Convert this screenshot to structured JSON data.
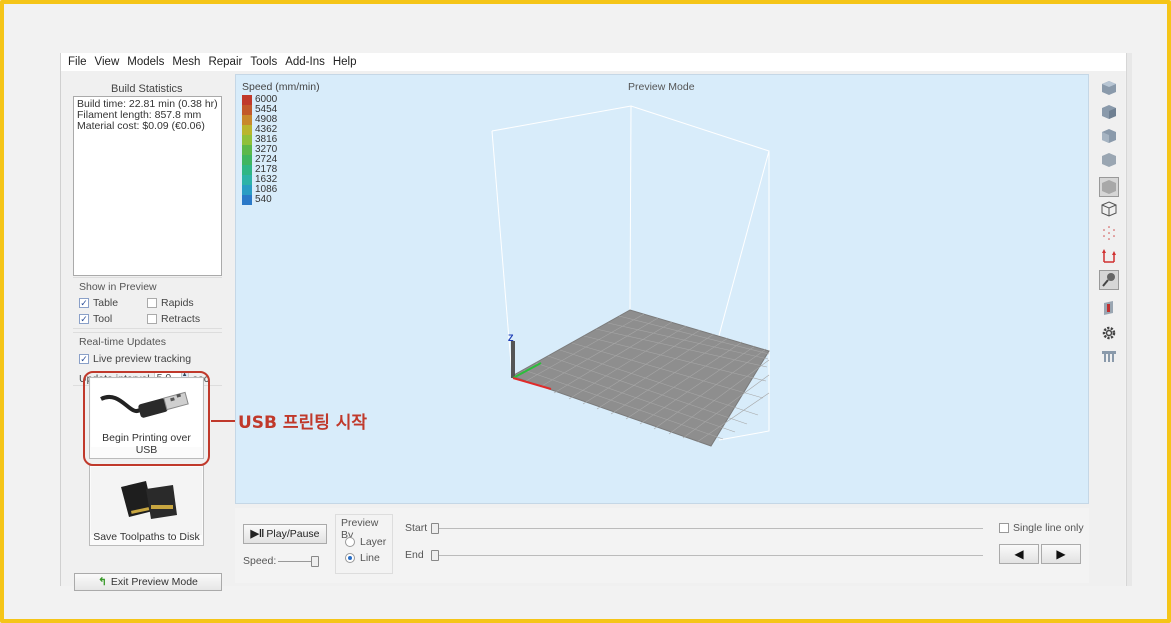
{
  "menu": [
    "File",
    "View",
    "Models",
    "Mesh",
    "Repair",
    "Tools",
    "Add-Ins",
    "Help"
  ],
  "build_statistics": {
    "title": "Build Statistics",
    "lines": [
      "Build time: 22.81 min (0.38 hr)",
      "Filament length: 857.8 mm",
      "Material cost: $0.09 (€0.06)"
    ]
  },
  "show_in_preview": {
    "title": "Show in Preview",
    "table": {
      "label": "Table",
      "checked": true
    },
    "rapids": {
      "label": "Rapids",
      "checked": false
    },
    "tool": {
      "label": "Tool",
      "checked": true
    },
    "retracts": {
      "label": "Retracts",
      "checked": false
    }
  },
  "realtime": {
    "title": "Real-time Updates",
    "live_label": "Live preview tracking",
    "live_checked": true,
    "interval_label": "Update interval",
    "interval_value": "5.0",
    "interval_unit": "sec"
  },
  "buttons": {
    "usb": "Begin Printing over USB",
    "sd": "Save Toolpaths to Disk",
    "exit": "Exit Preview Mode"
  },
  "annotation": "USB 프린팅 시작",
  "viewport": {
    "speed_title": "Speed (mm/min)",
    "mode": "Preview Mode",
    "legend": [
      {
        "value": "6000",
        "color": "#c0392b"
      },
      {
        "value": "5454",
        "color": "#c2582a"
      },
      {
        "value": "4908",
        "color": "#c8882c"
      },
      {
        "value": "4362",
        "color": "#b9b52e"
      },
      {
        "value": "3816",
        "color": "#8fc03a"
      },
      {
        "value": "3270",
        "color": "#5cb84a"
      },
      {
        "value": "2724",
        "color": "#3fb560"
      },
      {
        "value": "2178",
        "color": "#2fb685"
      },
      {
        "value": "1632",
        "color": "#2db3a8"
      },
      {
        "value": "1086",
        "color": "#2a9dc4"
      },
      {
        "value": "540",
        "color": "#2a79c8"
      }
    ],
    "axis_z": "Z"
  },
  "controls": {
    "play_pause": "Play/Pause",
    "speed_label": "Speed:",
    "preview_by": "Preview By",
    "layer": "Layer",
    "line": "Line",
    "selected": "Line",
    "start": "Start",
    "end": "End",
    "single_line": "Single line only",
    "prev": "◀",
    "next": "▶"
  },
  "toolbar_icons": [
    "cube-front-view-icon",
    "cube-side-view-icon",
    "cube-top-view-icon",
    "cube-back-view-icon",
    "cube-solid-view-icon",
    "wireframe-view-icon",
    "point-cloud-view-icon",
    "axis-arrows-icon",
    "pin-icon",
    "section-cut-icon",
    "settings-gear-icon",
    "bed-icon"
  ]
}
